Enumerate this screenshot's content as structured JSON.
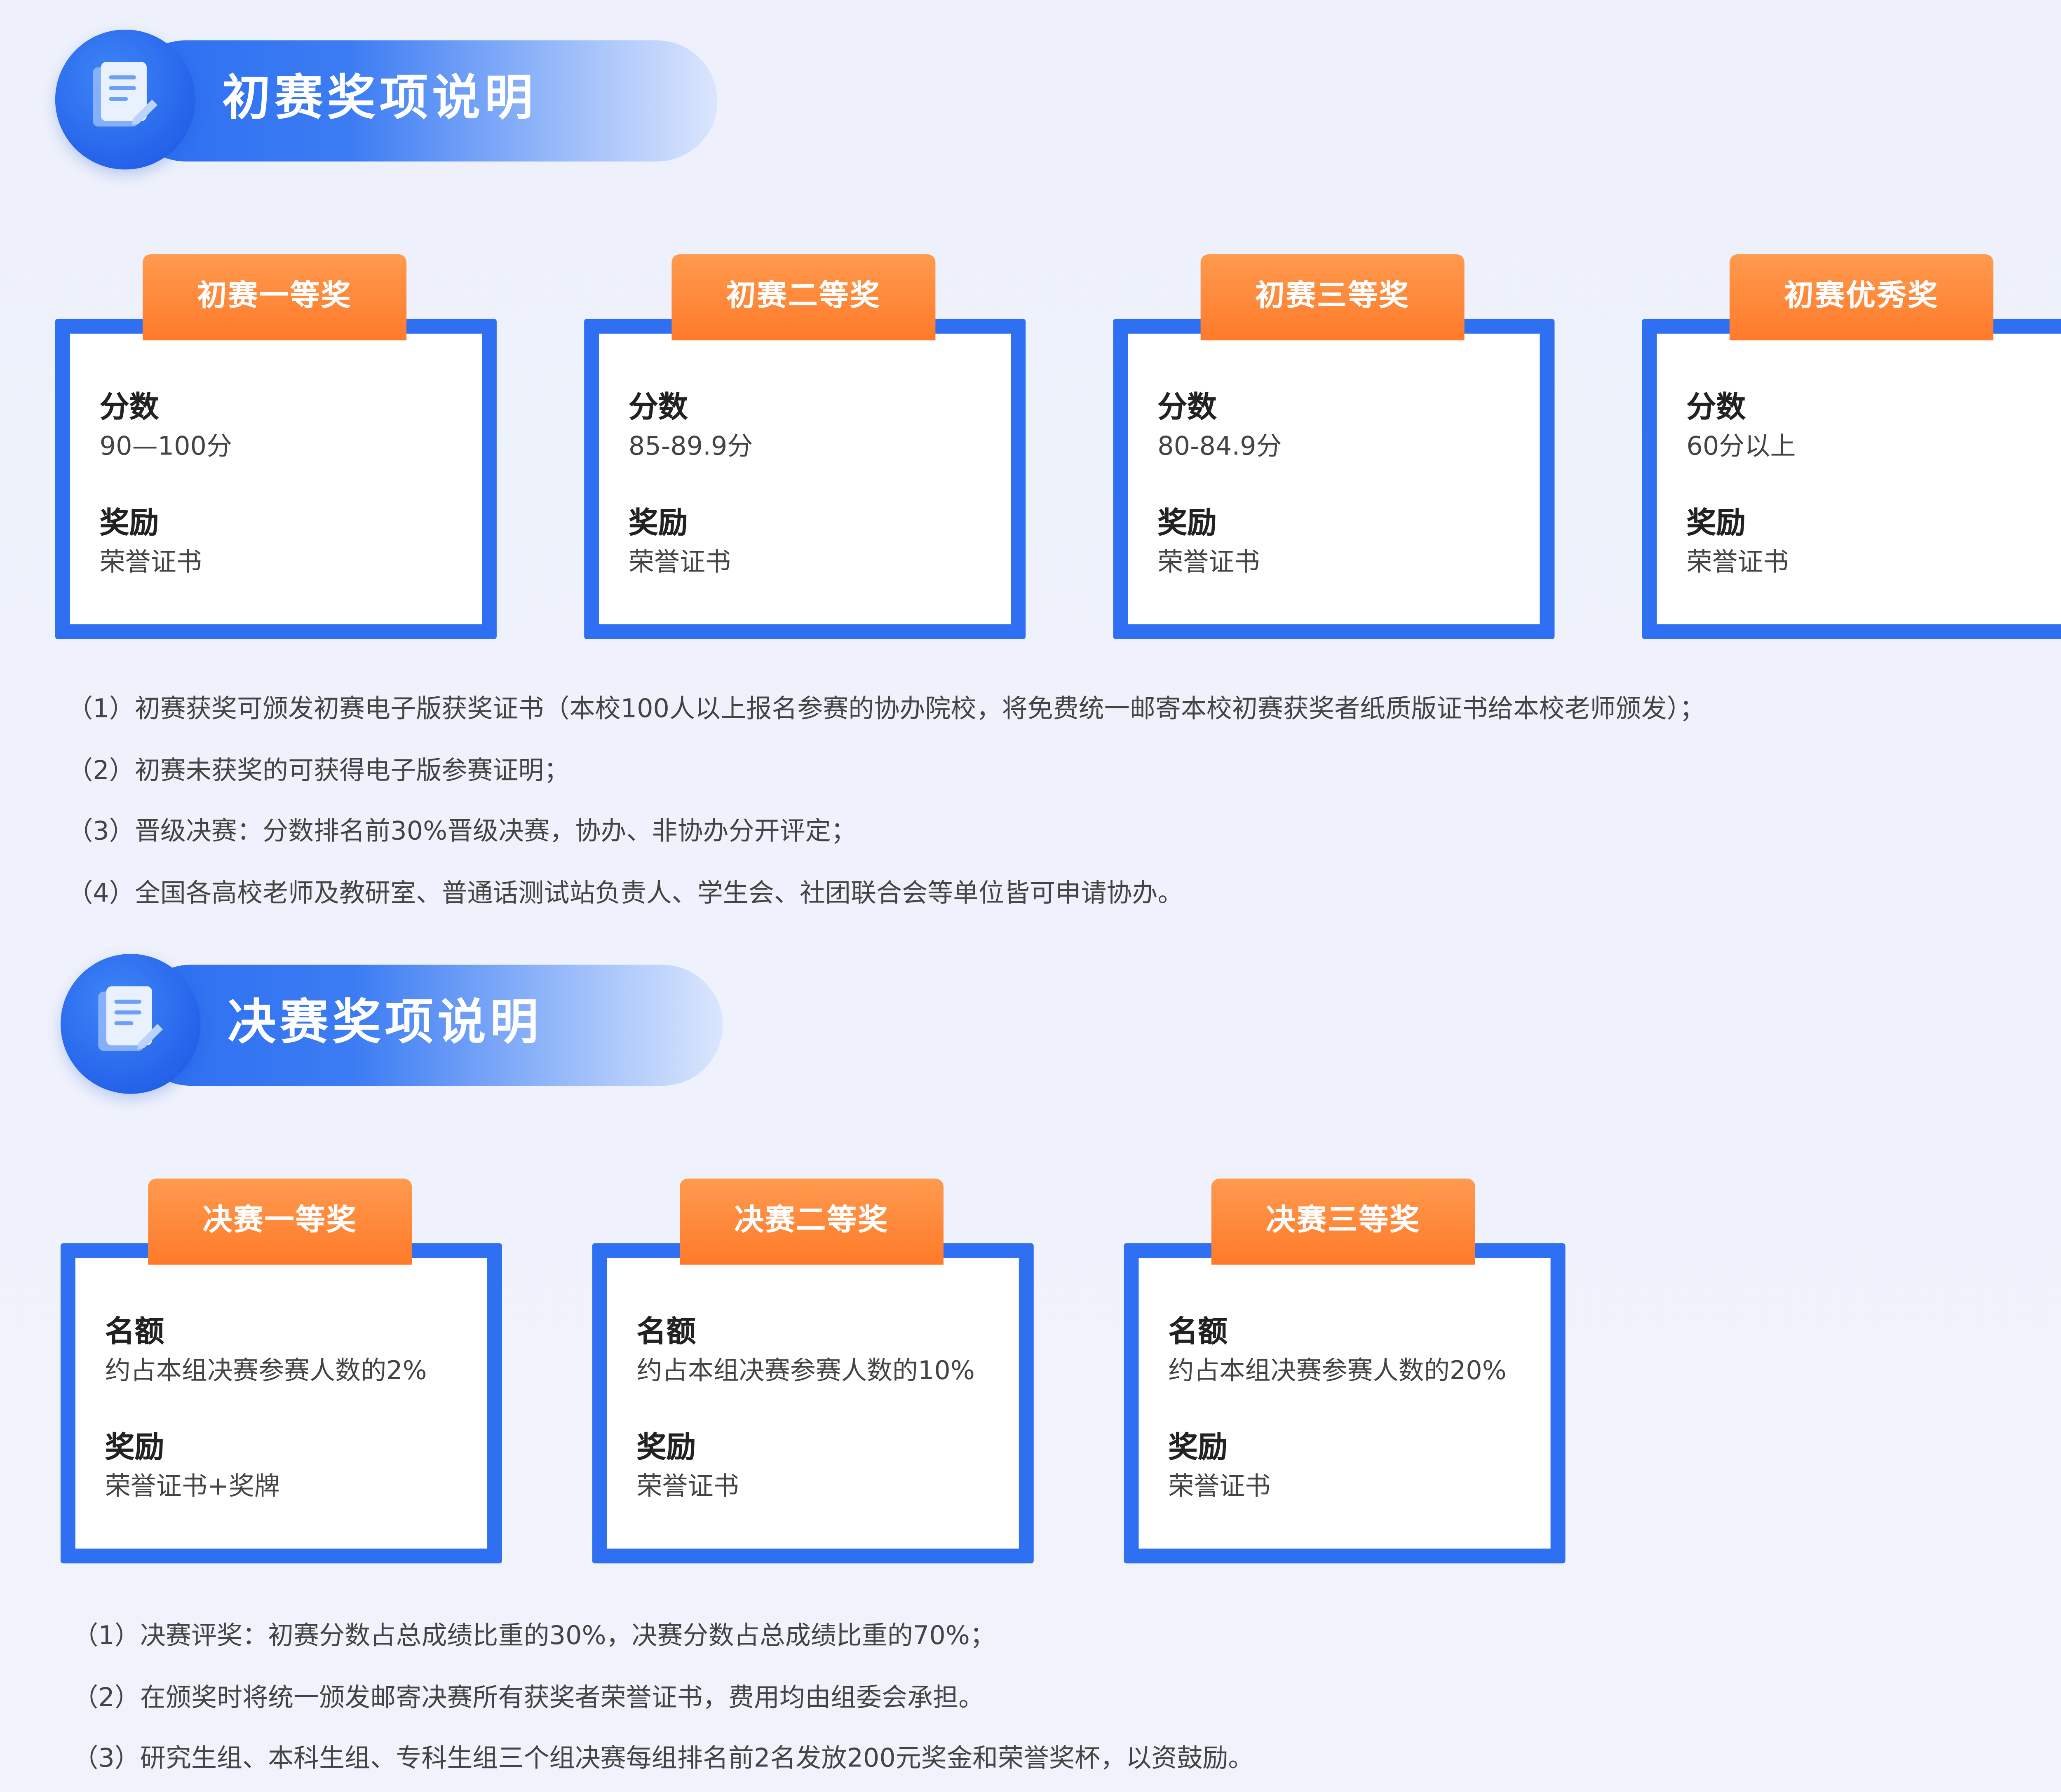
{
  "colors": {
    "brand_blue": "#2f70f2",
    "tab_orange": "#ff8a3a",
    "background": "#eef1fb"
  },
  "sections": [
    {
      "title": "初赛奖项说明",
      "icon": "document-icon",
      "cards": [
        {
          "tab": "初赛一等奖",
          "field1_label": "分数",
          "field1_value": "90—100分",
          "field2_label": "奖励",
          "field2_value": "荣誉证书"
        },
        {
          "tab": "初赛二等奖",
          "field1_label": "分数",
          "field1_value": "85-89.9分",
          "field2_label": "奖励",
          "field2_value": "荣誉证书"
        },
        {
          "tab": "初赛三等奖",
          "field1_label": "分数",
          "field1_value": "80-84.9分",
          "field2_label": "奖励",
          "field2_value": "荣誉证书"
        },
        {
          "tab": "初赛优秀奖",
          "field1_label": "分数",
          "field1_value": "60分以上",
          "field2_label": "奖励",
          "field2_value": "荣誉证书"
        }
      ],
      "notes": [
        "（1）初赛获奖可颁发初赛电子版获奖证书（本校100人以上报名参赛的协办院校，将免费统一邮寄本校初赛获奖者纸质版证书给本校老师颁发）；",
        "（2）初赛未获奖的可获得电子版参赛证明；",
        "（3）晋级决赛：分数排名前30%晋级决赛，协办、非协办分开评定；",
        "（4）全国各高校老师及教研室、普通话测试站负责人、学生会、社团联合会等单位皆可申请协办。"
      ]
    },
    {
      "title": "决赛奖项说明",
      "icon": "document-icon",
      "cards": [
        {
          "tab": "决赛一等奖",
          "field1_label": "名额",
          "field1_value": "约占本组决赛参赛人数的2%",
          "field2_label": "奖励",
          "field2_value": "荣誉证书+奖牌"
        },
        {
          "tab": "决赛二等奖",
          "field1_label": "名额",
          "field1_value": "约占本组决赛参赛人数的10%",
          "field2_label": "奖励",
          "field2_value": "荣誉证书"
        },
        {
          "tab": "决赛三等奖",
          "field1_label": "名额",
          "field1_value": "约占本组决赛参赛人数的20%",
          "field2_label": "奖励",
          "field2_value": "荣誉证书"
        }
      ],
      "notes": [
        "（1）决赛评奖：初赛分数占总成绩比重的30%，决赛分数占总成绩比重的70%；",
        "（2）在颁奖时将统一颁发邮寄决赛所有获奖者荣誉证书，费用均由组委会承担。",
        "（3）研究生组、本科生组、专科生组三个组决赛每组排名前2名发放200元奖金和荣誉奖杯，以资鼓励。"
      ]
    }
  ]
}
